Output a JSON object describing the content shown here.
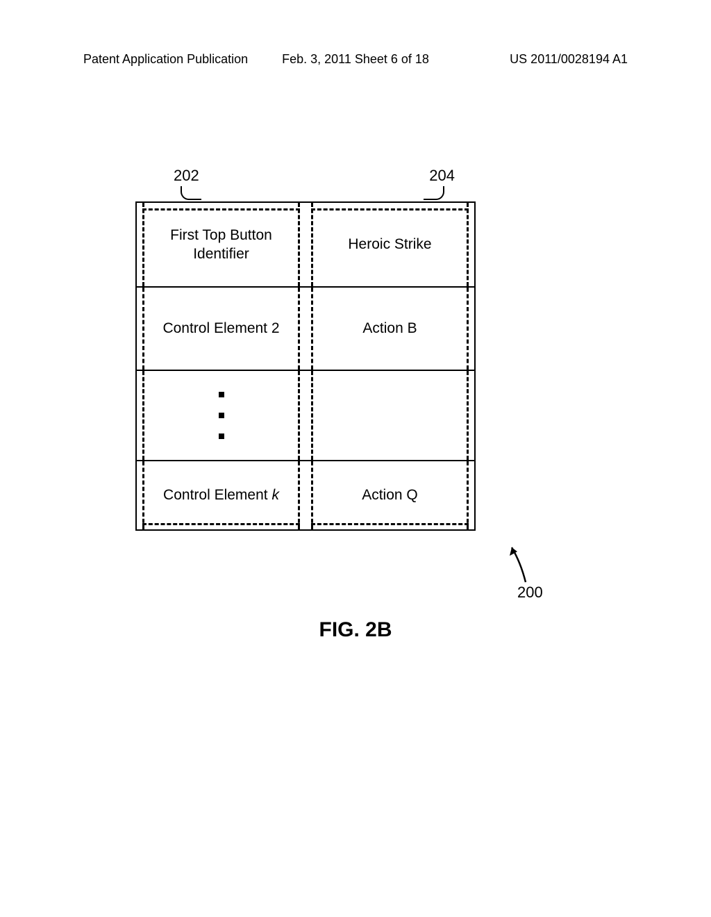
{
  "header": {
    "left": "Patent Application Publication",
    "center": "Feb. 3, 2011  Sheet 6 of 18",
    "right": "US 2011/0028194 A1"
  },
  "labels": {
    "col1": "202",
    "col2": "204",
    "figure_ref": "200"
  },
  "table": {
    "rows": [
      {
        "left": "First Top Button Identifier",
        "right": "Heroic Strike"
      },
      {
        "left": "Control Element 2",
        "right": "Action B"
      },
      {
        "left": "",
        "right": ""
      },
      {
        "left_prefix": "Control Element ",
        "left_suffix": "k",
        "right": "Action Q"
      }
    ]
  },
  "figure_label": "FIG. 2B"
}
